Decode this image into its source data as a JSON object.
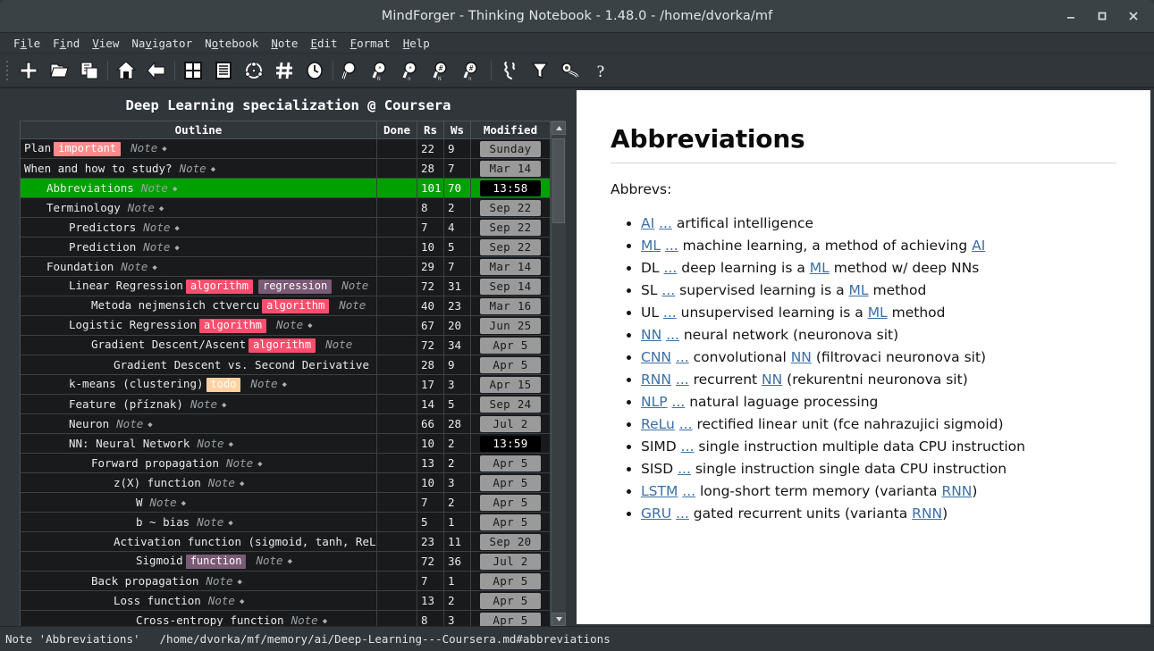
{
  "window": {
    "title": "MindForger - Thinking Notebook - 1.48.0 - /home/dvorka/mf",
    "minimize_label": "_",
    "maximize_label": "□",
    "close_label": "×"
  },
  "menubar": {
    "items": [
      {
        "label": "File",
        "pre": "F",
        "mnemonic": "i",
        "post": "le"
      },
      {
        "label": "Find",
        "pre": "F",
        "mnemonic": "i",
        "post": "nd"
      },
      {
        "label": "View",
        "pre": "",
        "mnemonic": "V",
        "post": "iew"
      },
      {
        "label": "Navigator",
        "pre": "Na",
        "mnemonic": "v",
        "post": "igator"
      },
      {
        "label": "Notebook",
        "pre": "N",
        "mnemonic": "o",
        "post": "tebook"
      },
      {
        "label": "Note",
        "pre": "",
        "mnemonic": "N",
        "post": "ote"
      },
      {
        "label": "Edit",
        "pre": "",
        "mnemonic": "E",
        "post": "dit"
      },
      {
        "label": "Format",
        "pre": "",
        "mnemonic": "F",
        "post": "ormat"
      },
      {
        "label": "Help",
        "pre": "",
        "mnemonic": "H",
        "post": "elp"
      }
    ]
  },
  "toolbar": {
    "buttons": [
      {
        "icon": "plus-icon",
        "label": "New"
      },
      {
        "icon": "open-folder-icon",
        "label": "Open"
      },
      {
        "icon": "copy-documents-icon",
        "label": "Open recent"
      },
      {
        "icon": "home-icon",
        "label": "Home"
      },
      {
        "icon": "back-arrow-icon",
        "label": "Back"
      },
      {
        "icon": "grid-view-icon",
        "label": "Dashboard"
      },
      {
        "icon": "list-view-icon",
        "label": "Notebooks"
      },
      {
        "icon": "knowledge-graph-icon",
        "label": "Knowledge graph"
      },
      {
        "icon": "hashtag-icon",
        "label": "Tags"
      },
      {
        "icon": "clock-icon",
        "label": "Recent notes"
      },
      {
        "icon": "search-icon",
        "label": "Full-text search"
      },
      {
        "icon": "search-n-icon",
        "label": "Find notebook by name"
      },
      {
        "icon": "search-small-n-icon",
        "label": "Find note by name"
      },
      {
        "icon": "search-hash-n-icon",
        "label": "Find notebook by tag"
      },
      {
        "icon": "search-hash-small-n-icon",
        "label": "Find note by tag"
      },
      {
        "icon": "scribble-icon",
        "label": "Think"
      },
      {
        "icon": "funnel-icon",
        "label": "Filter"
      },
      {
        "icon": "wrench-icon",
        "label": "Adapt"
      },
      {
        "icon": "help-icon",
        "label": "Help"
      }
    ]
  },
  "outline": {
    "title": "Deep Learning specialization @ Coursera",
    "columns": [
      "Outline",
      "Done",
      "Rs",
      "Ws",
      "Modified"
    ],
    "rows": [
      {
        "indent": 0,
        "name": "Plan",
        "tags": [
          {
            "label": "important",
            "color": "#ff8a8a"
          }
        ],
        "note": "Note",
        "done": "",
        "rs": "22",
        "ws": "9",
        "modified": "Sunday",
        "modified_kind": "date",
        "selected": false
      },
      {
        "indent": 0,
        "name": "When and how to study?",
        "tags": [],
        "note": "Note",
        "done": "",
        "rs": "28",
        "ws": "7",
        "modified": "Mar 14",
        "modified_kind": "date",
        "selected": false
      },
      {
        "indent": 1,
        "name": "Abbreviations",
        "tags": [],
        "note": "Note",
        "done": "",
        "rs": "101",
        "ws": "70",
        "modified": "13:58",
        "modified_kind": "time",
        "selected": true
      },
      {
        "indent": 1,
        "name": "Terminology",
        "tags": [],
        "note": "Note",
        "done": "",
        "rs": "8",
        "ws": "2",
        "modified": "Sep 22",
        "modified_kind": "date",
        "selected": false
      },
      {
        "indent": 2,
        "name": "Predictors",
        "tags": [],
        "note": "Note",
        "done": "",
        "rs": "7",
        "ws": "4",
        "modified": "Sep 22",
        "modified_kind": "date",
        "selected": false
      },
      {
        "indent": 2,
        "name": "Prediction",
        "tags": [],
        "note": "Note",
        "done": "",
        "rs": "10",
        "ws": "5",
        "modified": "Sep 22",
        "modified_kind": "date",
        "selected": false
      },
      {
        "indent": 1,
        "name": "Foundation",
        "tags": [],
        "note": "Note",
        "done": "",
        "rs": "29",
        "ws": "7",
        "modified": "Mar 14",
        "modified_kind": "date",
        "selected": false
      },
      {
        "indent": 2,
        "name": "Linear Regression",
        "tags": [
          {
            "label": "algorithm",
            "color": "#ff4d6d"
          },
          {
            "label": "regression",
            "color": "#7b5a75"
          }
        ],
        "note": "Note",
        "note_clipped": true,
        "done": "",
        "rs": "72",
        "ws": "31",
        "modified": "Sep 14",
        "modified_kind": "date",
        "selected": false
      },
      {
        "indent": 3,
        "name": "Metoda nejmensich ctvercu",
        "tags": [
          {
            "label": "algorithm",
            "color": "#ff4d6d"
          }
        ],
        "note": "Note",
        "note_clipped": true,
        "done": "",
        "rs": "40",
        "ws": "23",
        "modified": "Mar 16",
        "modified_kind": "date",
        "selected": false
      },
      {
        "indent": 2,
        "name": "Logistic Regression",
        "tags": [
          {
            "label": "algorithm",
            "color": "#ff4d6d"
          }
        ],
        "note": "Note",
        "done": "",
        "rs": "67",
        "ws": "20",
        "modified": "Jun 25",
        "modified_kind": "date",
        "selected": false
      },
      {
        "indent": 3,
        "name": "Gradient Descent/Ascent",
        "tags": [
          {
            "label": "algorithm",
            "color": "#ff4d6d"
          }
        ],
        "note": "Note",
        "note_clipped": true,
        "done": "",
        "rs": "72",
        "ws": "34",
        "modified": "Apr  5",
        "modified_kind": "date",
        "selected": false
      },
      {
        "indent": 4,
        "name": "Gradient Descent vs. Second Derivative",
        "tags": [],
        "note": "",
        "done": "",
        "rs": "28",
        "ws": "9",
        "modified": "Apr  5",
        "modified_kind": "date",
        "selected": false
      },
      {
        "indent": 2,
        "name": "k-means (clustering)",
        "tags": [
          {
            "label": "todo",
            "color": "#ffd2a0"
          }
        ],
        "note": "Note",
        "done": "",
        "rs": "17",
        "ws": "3",
        "modified": "Apr 15",
        "modified_kind": "date",
        "selected": false
      },
      {
        "indent": 2,
        "name": "Feature (příznak)",
        "tags": [],
        "note": "Note",
        "done": "",
        "rs": "14",
        "ws": "5",
        "modified": "Sep 24",
        "modified_kind": "date",
        "selected": false
      },
      {
        "indent": 2,
        "name": "Neuron",
        "tags": [],
        "note": "Note",
        "done": "",
        "rs": "66",
        "ws": "28",
        "modified": "Jul  2",
        "modified_kind": "date",
        "selected": false
      },
      {
        "indent": 2,
        "name": "NN: Neural Network",
        "tags": [],
        "note": "Note",
        "done": "",
        "rs": "10",
        "ws": "2",
        "modified": "13:59",
        "modified_kind": "time",
        "selected": false
      },
      {
        "indent": 3,
        "name": "Forward propagation",
        "tags": [],
        "note": "Note",
        "done": "",
        "rs": "13",
        "ws": "2",
        "modified": "Apr  5",
        "modified_kind": "date",
        "selected": false
      },
      {
        "indent": 4,
        "name": "z(X) function",
        "tags": [],
        "note": "Note",
        "done": "",
        "rs": "10",
        "ws": "3",
        "modified": "Apr  5",
        "modified_kind": "date",
        "selected": false
      },
      {
        "indent": 5,
        "name": "W",
        "tags": [],
        "note": "Note",
        "done": "",
        "rs": "7",
        "ws": "2",
        "modified": "Apr  5",
        "modified_kind": "date",
        "selected": false
      },
      {
        "indent": 5,
        "name": "b ~ bias",
        "tags": [],
        "note": "Note",
        "done": "",
        "rs": "5",
        "ws": "1",
        "modified": "Apr  5",
        "modified_kind": "date",
        "selected": false
      },
      {
        "indent": 4,
        "name": "Activation function (sigmoid, tanh, ReLU",
        "tags": [],
        "note": "",
        "note_clipped": true,
        "done": "",
        "rs": "23",
        "ws": "11",
        "modified": "Sep 20",
        "modified_kind": "date",
        "selected": false
      },
      {
        "indent": 5,
        "name": "Sigmoid",
        "tags": [
          {
            "label": "function",
            "color": "#7b5a75"
          }
        ],
        "note": "Note",
        "done": "",
        "rs": "72",
        "ws": "36",
        "modified": "Jul  2",
        "modified_kind": "date",
        "selected": false
      },
      {
        "indent": 3,
        "name": "Back propagation",
        "tags": [],
        "note": "Note",
        "done": "",
        "rs": "7",
        "ws": "1",
        "modified": "Apr  5",
        "modified_kind": "date",
        "selected": false
      },
      {
        "indent": 4,
        "name": "Loss function",
        "tags": [],
        "note": "Note",
        "done": "",
        "rs": "13",
        "ws": "2",
        "modified": "Apr  5",
        "modified_kind": "date",
        "selected": false
      },
      {
        "indent": 5,
        "name": "Cross-entropy function",
        "tags": [],
        "note": "Note",
        "done": "",
        "rs": "8",
        "ws": "3",
        "modified": "Apr  5",
        "modified_kind": "date",
        "selected": false
      }
    ]
  },
  "note": {
    "heading": "Abbreviations",
    "intro": "Abbrevs:",
    "items": [
      {
        "abbr": "AI",
        "abbr_link": true,
        "ellipsis_link": true,
        "text_before": " artifical intelligence",
        "tail_link": "",
        "text_after": ""
      },
      {
        "abbr": "ML",
        "abbr_link": true,
        "ellipsis_link": true,
        "text_before": " machine learning, a method of achieving ",
        "tail_link": "AI",
        "text_after": ""
      },
      {
        "abbr": "DL",
        "abbr_link": false,
        "ellipsis_link": true,
        "text_before": " deep learning is a ",
        "tail_link": "ML",
        "text_after": " method w/ deep NNs"
      },
      {
        "abbr": "SL",
        "abbr_link": false,
        "ellipsis_link": true,
        "text_before": " supervised learning is a ",
        "tail_link": "ML",
        "text_after": " method"
      },
      {
        "abbr": "UL",
        "abbr_link": false,
        "ellipsis_link": true,
        "text_before": " unsupervised learning is a ",
        "tail_link": "ML",
        "text_after": " method"
      },
      {
        "abbr": "NN",
        "abbr_link": true,
        "ellipsis_link": true,
        "text_before": " neural network (neuronova sit)",
        "tail_link": "",
        "text_after": ""
      },
      {
        "abbr": "CNN",
        "abbr_link": true,
        "ellipsis_link": true,
        "text_before": " convolutional ",
        "tail_link": "NN",
        "text_after": " (filtrovaci neuronova sit)"
      },
      {
        "abbr": "RNN",
        "abbr_link": true,
        "ellipsis_link": true,
        "text_before": " recurrent ",
        "tail_link": "NN",
        "text_after": " (rekurentni neuronova sit)"
      },
      {
        "abbr": "NLP",
        "abbr_link": true,
        "ellipsis_link": true,
        "text_before": " natural laguage processing",
        "tail_link": "",
        "text_after": ""
      },
      {
        "abbr": "ReLu",
        "abbr_link": true,
        "ellipsis_link": true,
        "text_before": " rectified linear unit (fce nahrazujici sigmoid)",
        "tail_link": "",
        "text_after": ""
      },
      {
        "abbr": "SIMD",
        "abbr_link": false,
        "ellipsis_link": true,
        "text_before": " single instruction multiple data CPU instruction",
        "tail_link": "",
        "text_after": ""
      },
      {
        "abbr": "SISD",
        "abbr_link": false,
        "ellipsis_link": true,
        "text_before": " single instruction single data CPU instruction",
        "tail_link": "",
        "text_after": ""
      },
      {
        "abbr": "LSTM",
        "abbr_link": true,
        "ellipsis_link": true,
        "text_before": " long-short term memory (varianta ",
        "tail_link": "RNN",
        "text_after": ")"
      },
      {
        "abbr": "GRU",
        "abbr_link": true,
        "ellipsis_link": true,
        "text_before": " gated recurrent units (varianta ",
        "tail_link": "RNN",
        "text_after": ")"
      }
    ],
    "ellipsis": "..."
  },
  "statusbar": {
    "note_label": "Note 'Abbreviations'",
    "path": "/home/dvorka/mf/memory/ai/Deep-Learning---Coursera.md#abbreviations"
  },
  "colors": {
    "selection_green": "#00a000",
    "tag_important": "#ff8a8a",
    "tag_algorithm": "#ff4d6d",
    "tag_regression": "#7b5a75",
    "tag_todo": "#ffd2a0",
    "tag_function": "#7b5a75",
    "link_blue": "#3c6fa8"
  }
}
